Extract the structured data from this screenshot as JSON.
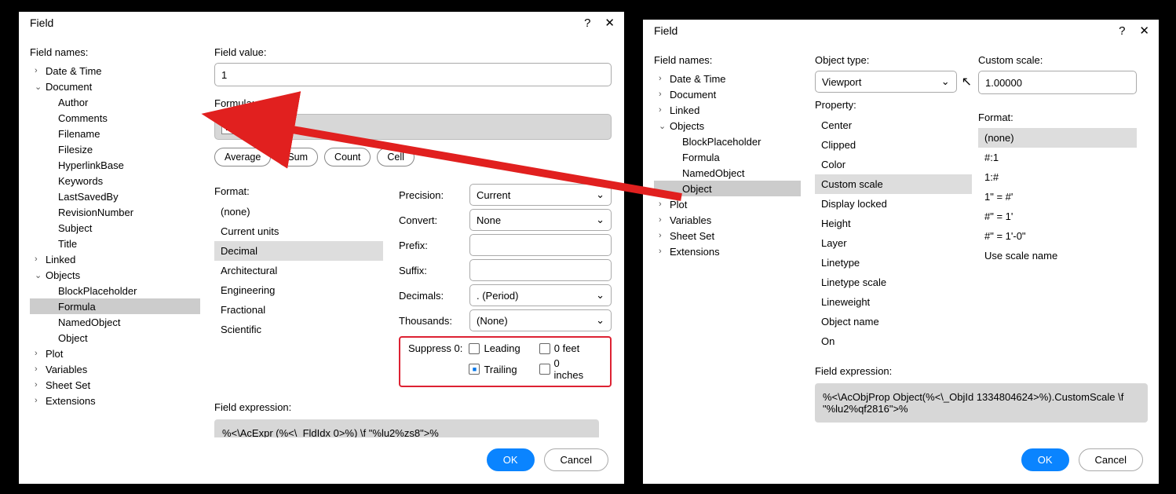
{
  "dialog_left": {
    "title": "Field",
    "field_names_label": "Field names:",
    "tree": [
      {
        "label": "Date & Time",
        "arrow": "›",
        "depth": 0
      },
      {
        "label": "Document",
        "arrow": "⌄",
        "depth": 0
      },
      {
        "label": "Author",
        "arrow": "",
        "depth": 1
      },
      {
        "label": "Comments",
        "arrow": "",
        "depth": 1
      },
      {
        "label": "Filename",
        "arrow": "",
        "depth": 1
      },
      {
        "label": "Filesize",
        "arrow": "",
        "depth": 1
      },
      {
        "label": "HyperlinkBase",
        "arrow": "",
        "depth": 1
      },
      {
        "label": "Keywords",
        "arrow": "",
        "depth": 1
      },
      {
        "label": "LastSavedBy",
        "arrow": "",
        "depth": 1
      },
      {
        "label": "RevisionNumber",
        "arrow": "",
        "depth": 1
      },
      {
        "label": "Subject",
        "arrow": "",
        "depth": 1
      },
      {
        "label": "Title",
        "arrow": "",
        "depth": 1
      },
      {
        "label": "Linked",
        "arrow": "›",
        "depth": 0
      },
      {
        "label": "Objects",
        "arrow": "⌄",
        "depth": 0
      },
      {
        "label": "BlockPlaceholder",
        "arrow": "",
        "depth": 1
      },
      {
        "label": "Formula",
        "arrow": "",
        "depth": 1,
        "selected": true
      },
      {
        "label": "NamedObject",
        "arrow": "",
        "depth": 1
      },
      {
        "label": "Object",
        "arrow": "",
        "depth": 1
      },
      {
        "label": "Plot",
        "arrow": "›",
        "depth": 0
      },
      {
        "label": "Variables",
        "arrow": "›",
        "depth": 0
      },
      {
        "label": "Sheet Set",
        "arrow": "›",
        "depth": 0
      },
      {
        "label": "Extensions",
        "arrow": "›",
        "depth": 0
      }
    ],
    "field_value_label": "Field value:",
    "field_value": "1",
    "formula_label": "Formula:",
    "formula_value": "1.00000",
    "pills": [
      "Average",
      "Sum",
      "Count",
      "Cell"
    ],
    "format_label": "Format:",
    "formats": [
      "(none)",
      "Current units",
      "Decimal",
      "Architectural",
      "Engineering",
      "Fractional",
      "Scientific"
    ],
    "format_selected": "Decimal",
    "precision_label": "Precision:",
    "precision_value": "Current",
    "convert_label": "Convert:",
    "convert_value": "None",
    "prefix_label": "Prefix:",
    "prefix_value": "",
    "suffix_label": "Suffix:",
    "suffix_value": "",
    "decimals_label": "Decimals:",
    "decimals_value": ". (Period)",
    "thousands_label": "Thousands:",
    "thousands_value": "(None)",
    "suppress_label": "Suppress 0:",
    "suppress": [
      {
        "label": "Leading",
        "checked": false
      },
      {
        "label": "0 feet",
        "checked": false
      },
      {
        "label": "Trailing",
        "checked": true
      },
      {
        "label": "0 inches",
        "checked": false
      }
    ],
    "expr_label": "Field expression:",
    "expr_value": "%<\\AcExpr (%<\\_FldIdx 0>%) \\f \"%lu2%zs8\">%",
    "ok": "OK",
    "cancel": "Cancel"
  },
  "dialog_right": {
    "title": "Field",
    "field_names_label": "Field names:",
    "tree": [
      {
        "label": "Date & Time",
        "arrow": "›",
        "depth": 0
      },
      {
        "label": "Document",
        "arrow": "›",
        "depth": 0
      },
      {
        "label": "Linked",
        "arrow": "›",
        "depth": 0
      },
      {
        "label": "Objects",
        "arrow": "⌄",
        "depth": 0
      },
      {
        "label": "BlockPlaceholder",
        "arrow": "",
        "depth": 1
      },
      {
        "label": "Formula",
        "arrow": "",
        "depth": 1
      },
      {
        "label": "NamedObject",
        "arrow": "",
        "depth": 1
      },
      {
        "label": "Object",
        "arrow": "",
        "depth": 1,
        "selected": true
      },
      {
        "label": "Plot",
        "arrow": "›",
        "depth": 0
      },
      {
        "label": "Variables",
        "arrow": "›",
        "depth": 0
      },
      {
        "label": "Sheet Set",
        "arrow": "›",
        "depth": 0
      },
      {
        "label": "Extensions",
        "arrow": "›",
        "depth": 0
      }
    ],
    "objtype_label": "Object type:",
    "objtype_value": "Viewport",
    "property_label": "Property:",
    "properties": [
      "Center",
      "Clipped",
      "Color",
      "Custom scale",
      "Display locked",
      "Height",
      "Layer",
      "Linetype",
      "Linetype scale",
      "Lineweight",
      "Object name",
      "On"
    ],
    "property_selected": "Custom scale",
    "custom_scale_label": "Custom scale:",
    "custom_scale_value": "1.00000",
    "format_label": "Format:",
    "formats": [
      "(none)",
      "#:1",
      "1:#",
      "1\" = #'",
      "#\" = 1'",
      "#\" = 1'-0\"",
      "Use scale name"
    ],
    "format_selected": "(none)",
    "expr_label": "Field expression:",
    "expr_value": "%<\\AcObjProp Object(%<\\_ObjId 1334804624>%).CustomScale \\f \"%lu2%qf2816\">%",
    "ok": "OK",
    "cancel": "Cancel"
  }
}
